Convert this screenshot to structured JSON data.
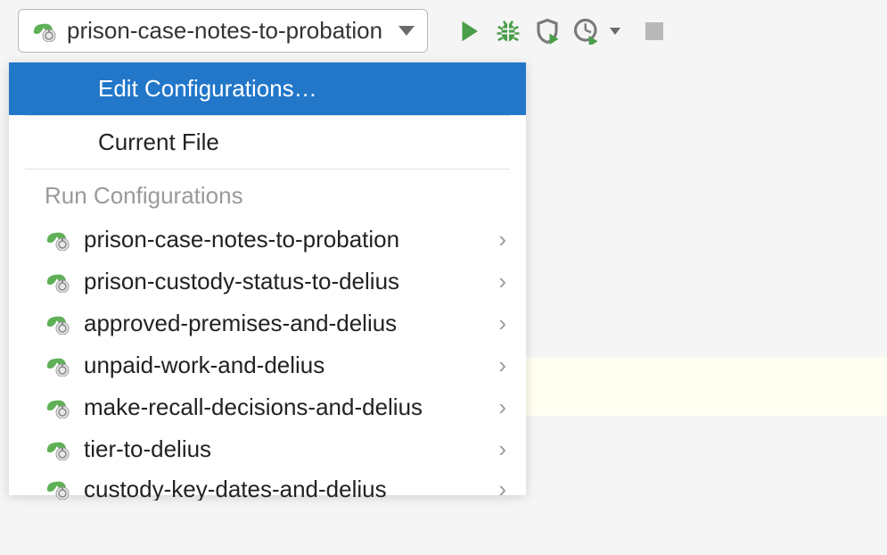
{
  "toolbar": {
    "selected_config": "prison-case-notes-to-probation"
  },
  "dropdown": {
    "edit_label": "Edit Configurations…",
    "current_file_label": "Current File",
    "section_header": "Run Configurations",
    "items": [
      {
        "name": "prison-case-notes-to-probation"
      },
      {
        "name": "prison-custody-status-to-delius"
      },
      {
        "name": "approved-premises-and-delius"
      },
      {
        "name": "unpaid-work-and-delius"
      },
      {
        "name": "make-recall-decisions-and-delius"
      },
      {
        "name": "tier-to-delius"
      },
      {
        "name": "custody-key-dates-and-delius"
      }
    ]
  }
}
